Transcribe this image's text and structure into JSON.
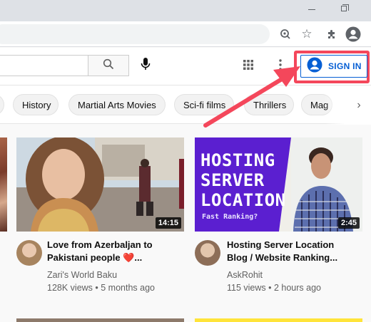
{
  "browser": {
    "icons": [
      "lens-icon",
      "star-icon",
      "extensions-icon",
      "profile-icon"
    ]
  },
  "masthead": {
    "sign_in_label": "SIGN IN",
    "icons": [
      "search-icon",
      "mic-icon",
      "apps-grid-icon",
      "more-vert-icon",
      "account-circle-icon"
    ]
  },
  "chips": [
    {
      "label": ""
    },
    {
      "label": "History"
    },
    {
      "label": "Martial Arts Movies"
    },
    {
      "label": "Sci-fi films"
    },
    {
      "label": "Thrillers"
    },
    {
      "label": "Mag"
    }
  ],
  "videos": [
    {
      "title": "Love from Azerbaljan to Pakistani people ❤️...",
      "channel": "Zari's World Baku",
      "meta": "128K views • 5 months ago",
      "duration": "14:15"
    },
    {
      "title": "Hosting Server Location Blog / Website Ranking...",
      "channel": "AskRohit",
      "meta": "115 views • 2 hours ago",
      "duration": "2:45",
      "thumb_title": [
        "HOSTING",
        "SERVER",
        "LOCATION"
      ],
      "thumb_subtitle": "Fast Ranking?"
    }
  ],
  "colors": {
    "highlight": "#f4475b",
    "signin": "#065fd4",
    "thumb_purple": "#5b1fd0"
  }
}
